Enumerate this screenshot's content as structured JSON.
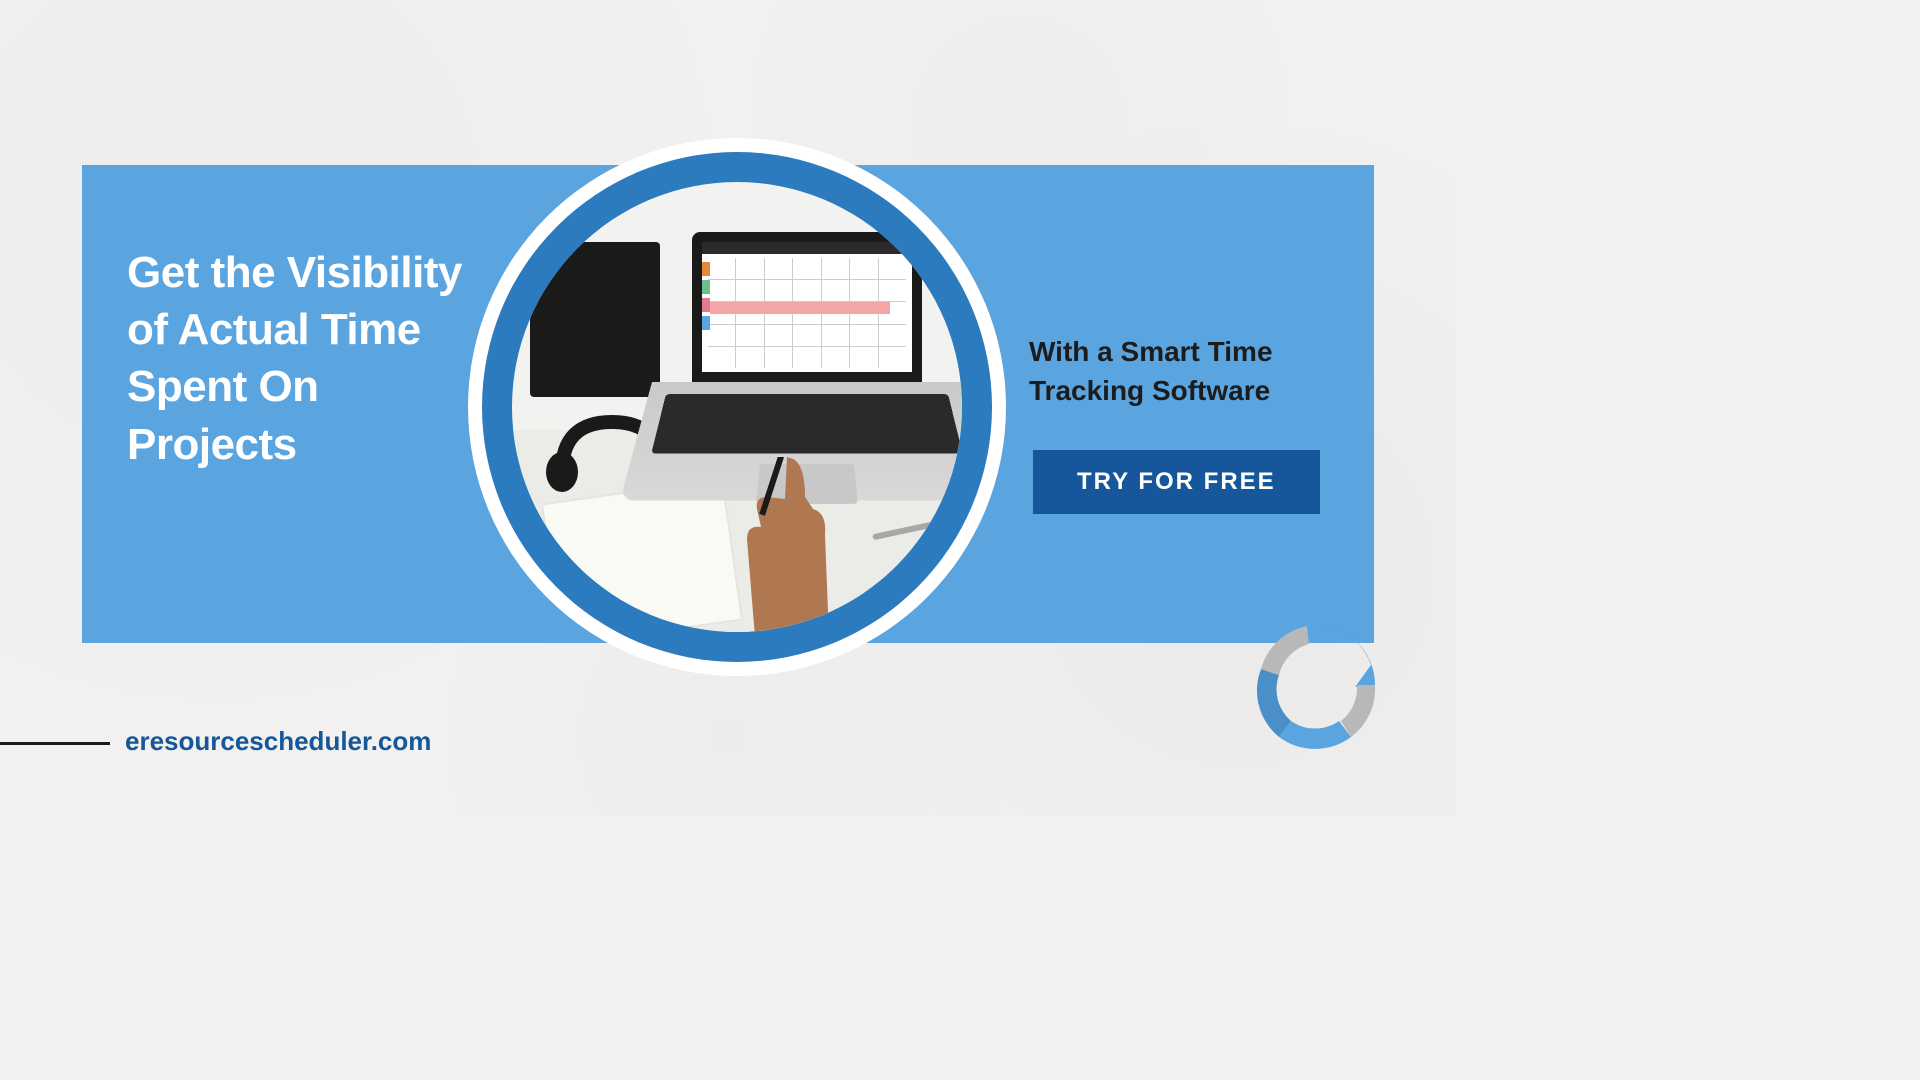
{
  "banner": {
    "headline": "Get the Visibility of Actual Time Spent On Projects",
    "subhead": "With a Smart Time Tracking Software",
    "cta_label": "TRY FOR FREE"
  },
  "footer": {
    "url": "eresourcescheduler.com"
  },
  "colors": {
    "banner_bg": "#5aa4e0",
    "cta_bg": "#15579a",
    "ring": "#2c7bbf",
    "accent": "#15579a"
  }
}
